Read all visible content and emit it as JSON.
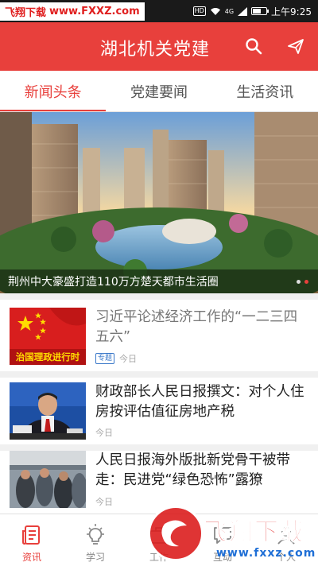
{
  "watermark_top": {
    "site": "飞翔下载",
    "url": "www.FXXZ.com"
  },
  "status_bar": {
    "hd": "HD",
    "signal_label": "4G",
    "time": "上午9:25",
    "battery_level": 0.55
  },
  "header": {
    "title": "湖北机关党建",
    "search_icon": "search-icon",
    "share_icon": "send-icon"
  },
  "tabs": [
    {
      "label": "新闻头条",
      "active": true
    },
    {
      "label": "党建要闻",
      "active": false
    },
    {
      "label": "生活资讯",
      "active": false
    }
  ],
  "banner": {
    "caption": "荆州中大豪盛打造110万方楚天都市生活圈",
    "dots": 2,
    "active_dot": 1
  },
  "news": [
    {
      "title": "习近平论述经济工作的“一二三四五六”",
      "thumb_label": "治国理政进行时",
      "tag": "专题",
      "time": "今日"
    },
    {
      "title": "财政部长人民日报撰文：对个人住房按评估值征房地产税",
      "time": "今日"
    },
    {
      "title": "人民日报海外版批新党骨干被带走：民进党“绿色恐怖”露獠",
      "time": "今日"
    }
  ],
  "bottom_nav": [
    {
      "label": "资讯",
      "icon": "news-icon",
      "active": true
    },
    {
      "label": "学习",
      "icon": "bulb-icon",
      "active": false
    },
    {
      "label": "工作",
      "icon": "work-icon",
      "active": false
    },
    {
      "label": "互动",
      "icon": "chat-icon",
      "active": false
    },
    {
      "label": "个人",
      "icon": "user-icon",
      "active": false
    }
  ],
  "watermark_logo": {
    "text": "飞翔下载",
    "url": "www.fxxz.com"
  },
  "colors": {
    "accent": "#e8403c",
    "tag_blue": "#3a78c9"
  }
}
